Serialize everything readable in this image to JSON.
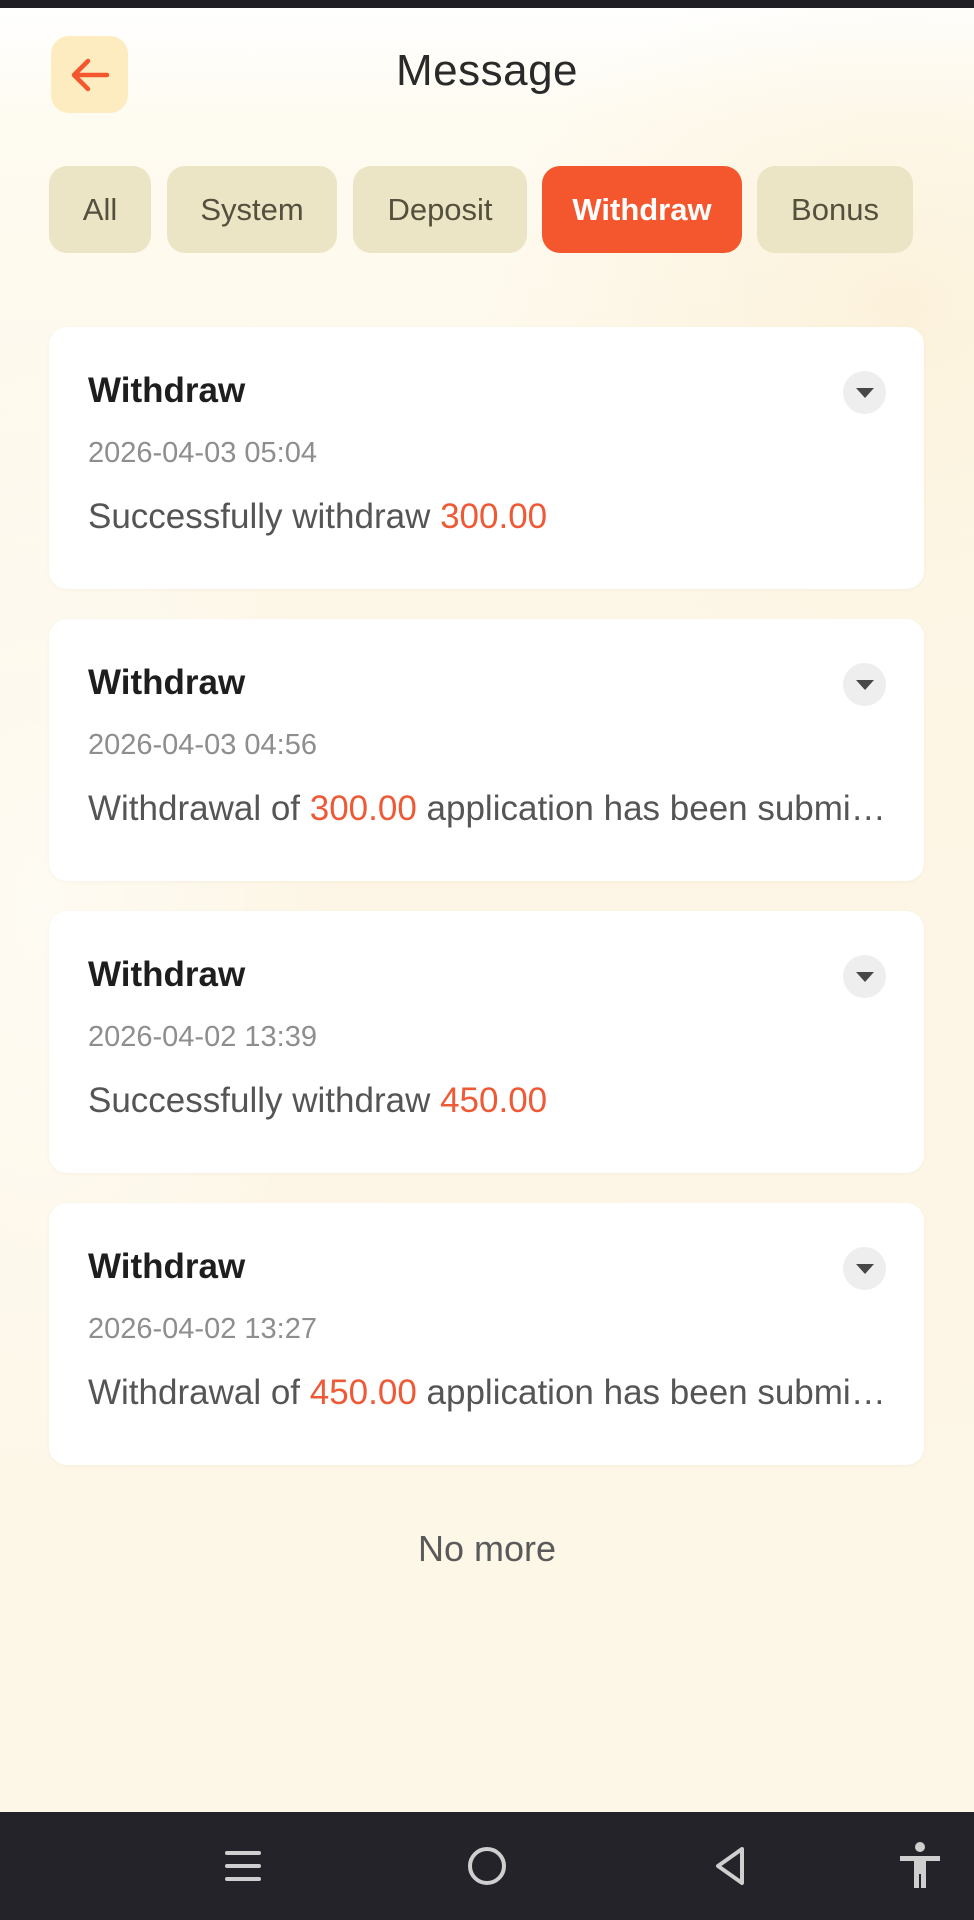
{
  "header": {
    "title": "Message",
    "back_icon": "arrow-left-icon"
  },
  "tabs": [
    {
      "label": "All",
      "active": false
    },
    {
      "label": "System",
      "active": false
    },
    {
      "label": "Deposit",
      "active": false
    },
    {
      "label": "Withdraw",
      "active": true
    },
    {
      "label": "Bonus",
      "active": false
    }
  ],
  "messages": [
    {
      "title": "Withdraw",
      "time": "2026-04-03 05:04",
      "prefix": "Successfully withdraw ",
      "amount": "300.00",
      "suffix": ""
    },
    {
      "title": "Withdraw",
      "time": "2026-04-03 04:56",
      "prefix": "Withdrawal of ",
      "amount": "300.00",
      "suffix": " application has been submitted"
    },
    {
      "title": "Withdraw",
      "time": "2026-04-02 13:39",
      "prefix": "Successfully withdraw ",
      "amount": "450.00",
      "suffix": ""
    },
    {
      "title": "Withdraw",
      "time": "2026-04-02 13:27",
      "prefix": "Withdrawal of ",
      "amount": "450.00",
      "suffix": " application has been submitted"
    }
  ],
  "list_end_text": "No more",
  "colors": {
    "accent": "#f4572d",
    "amount": "#ee5a36",
    "tab_bg": "#ebe5c5",
    "back_button_bg": "#fdecc0",
    "nav_bar_bg": "#24232a"
  },
  "system_nav": {
    "icons": [
      "menu-icon",
      "home-circle-icon",
      "back-triangle-icon",
      "accessibility-icon"
    ]
  }
}
